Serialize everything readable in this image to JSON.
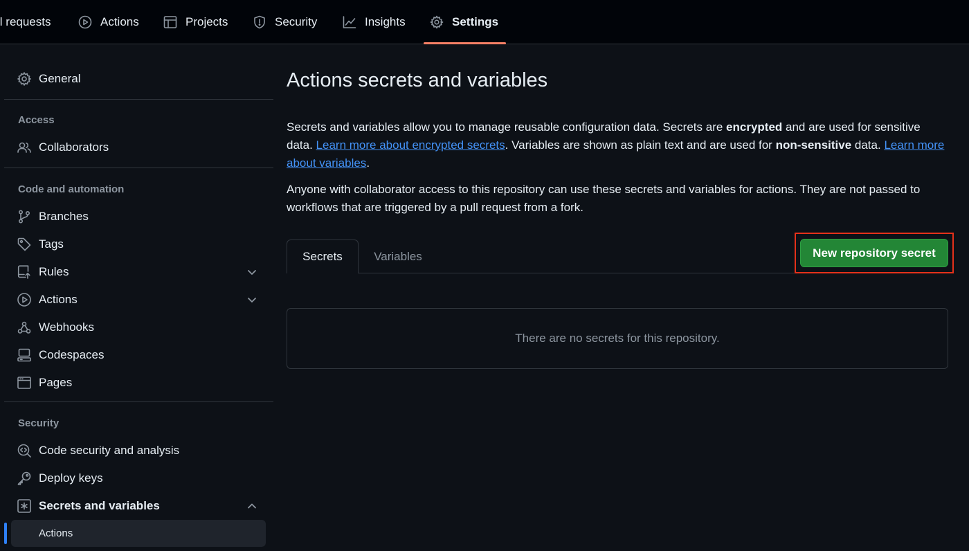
{
  "topnav": {
    "tabs": [
      {
        "label": "ll requests",
        "icon": "pull-request-icon"
      },
      {
        "label": "Actions",
        "icon": "play-circle-icon"
      },
      {
        "label": "Projects",
        "icon": "table-icon"
      },
      {
        "label": "Security",
        "icon": "shield-icon"
      },
      {
        "label": "Insights",
        "icon": "graph-icon"
      },
      {
        "label": "Settings",
        "icon": "gear-icon",
        "active": true
      }
    ]
  },
  "sidebar": {
    "general": "General",
    "sections": [
      {
        "heading": "Access",
        "items": [
          "Collaborators"
        ]
      },
      {
        "heading": "Code and automation",
        "items": [
          "Branches",
          "Tags",
          "Rules",
          "Actions",
          "Webhooks",
          "Codespaces",
          "Pages"
        ]
      },
      {
        "heading": "Security",
        "items": [
          "Code security and analysis",
          "Deploy keys",
          "Secrets and variables"
        ]
      }
    ],
    "sub_item": "Actions"
  },
  "main": {
    "title": "Actions secrets and variables",
    "para1": {
      "t1": "Secrets and variables allow you to manage reusable configuration data. Secrets are ",
      "b1": "encrypted",
      "t2": " and are used for sensitive data. ",
      "link1": "Learn more about encrypted secrets",
      "t3": ". Variables are shown as plain text and are used for ",
      "b2": "non-sensitive",
      "t4": " data. ",
      "link2": "Learn more about variables",
      "t5": "."
    },
    "para2": "Anyone with collaborator access to this repository can use these secrets and variables for actions. They are not passed to workflows that are triggered by a pull request from a fork.",
    "tabs": [
      "Secrets",
      "Variables"
    ],
    "new_button": "New repository secret",
    "empty_message": "There are no secrets for this repository."
  },
  "colors": {
    "accent_underline": "#f78166",
    "primary_button": "#238636",
    "link": "#4493f8",
    "highlight_box": "#e5311a"
  }
}
